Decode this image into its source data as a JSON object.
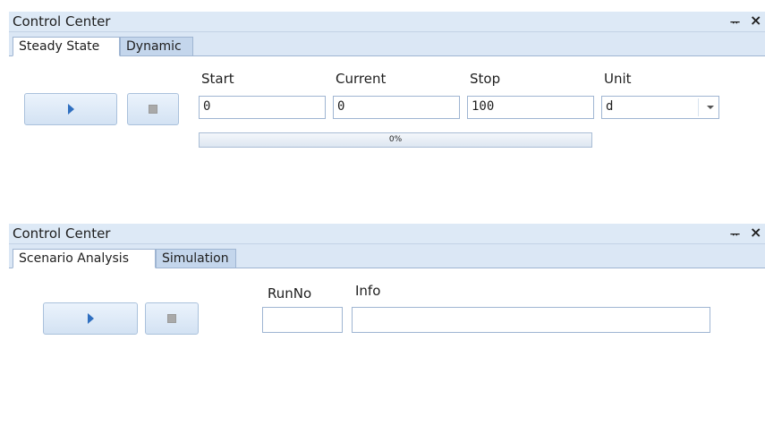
{
  "panel_top": {
    "title": "Control Center",
    "pin_glyph": "ᅲ",
    "close_glyph": "×",
    "tabs": [
      {
        "label": "Steady State",
        "active": true
      },
      {
        "label": "Dynamic",
        "active": false
      }
    ],
    "labels": {
      "start": "Start",
      "current": "Current",
      "stop": "Stop",
      "unit": "Unit"
    },
    "fields": {
      "start": "0",
      "current": "0",
      "stop": "100",
      "unit": "d"
    },
    "progress": {
      "percent": 0,
      "text": "0%"
    },
    "icons": {
      "run": "play-icon",
      "stop": "stop-icon",
      "unit_dropdown": "chevron-down-icon"
    }
  },
  "panel_bottom": {
    "title": "Control Center",
    "pin_glyph": "ᅲ",
    "close_glyph": "×",
    "tabs": [
      {
        "label": "Scenario Analysis",
        "active": true
      },
      {
        "label": "Simulation",
        "active": false
      }
    ],
    "labels": {
      "runno": "RunNo",
      "info": "Info"
    },
    "fields": {
      "runno": "",
      "info": ""
    },
    "icons": {
      "run": "play-icon",
      "stop": "stop-icon"
    }
  },
  "colors": {
    "titlebar": "#dde9f6",
    "tabstrip": "#dbe7f5",
    "accent": "#2f6fc0",
    "border": "#9fb5d2"
  }
}
